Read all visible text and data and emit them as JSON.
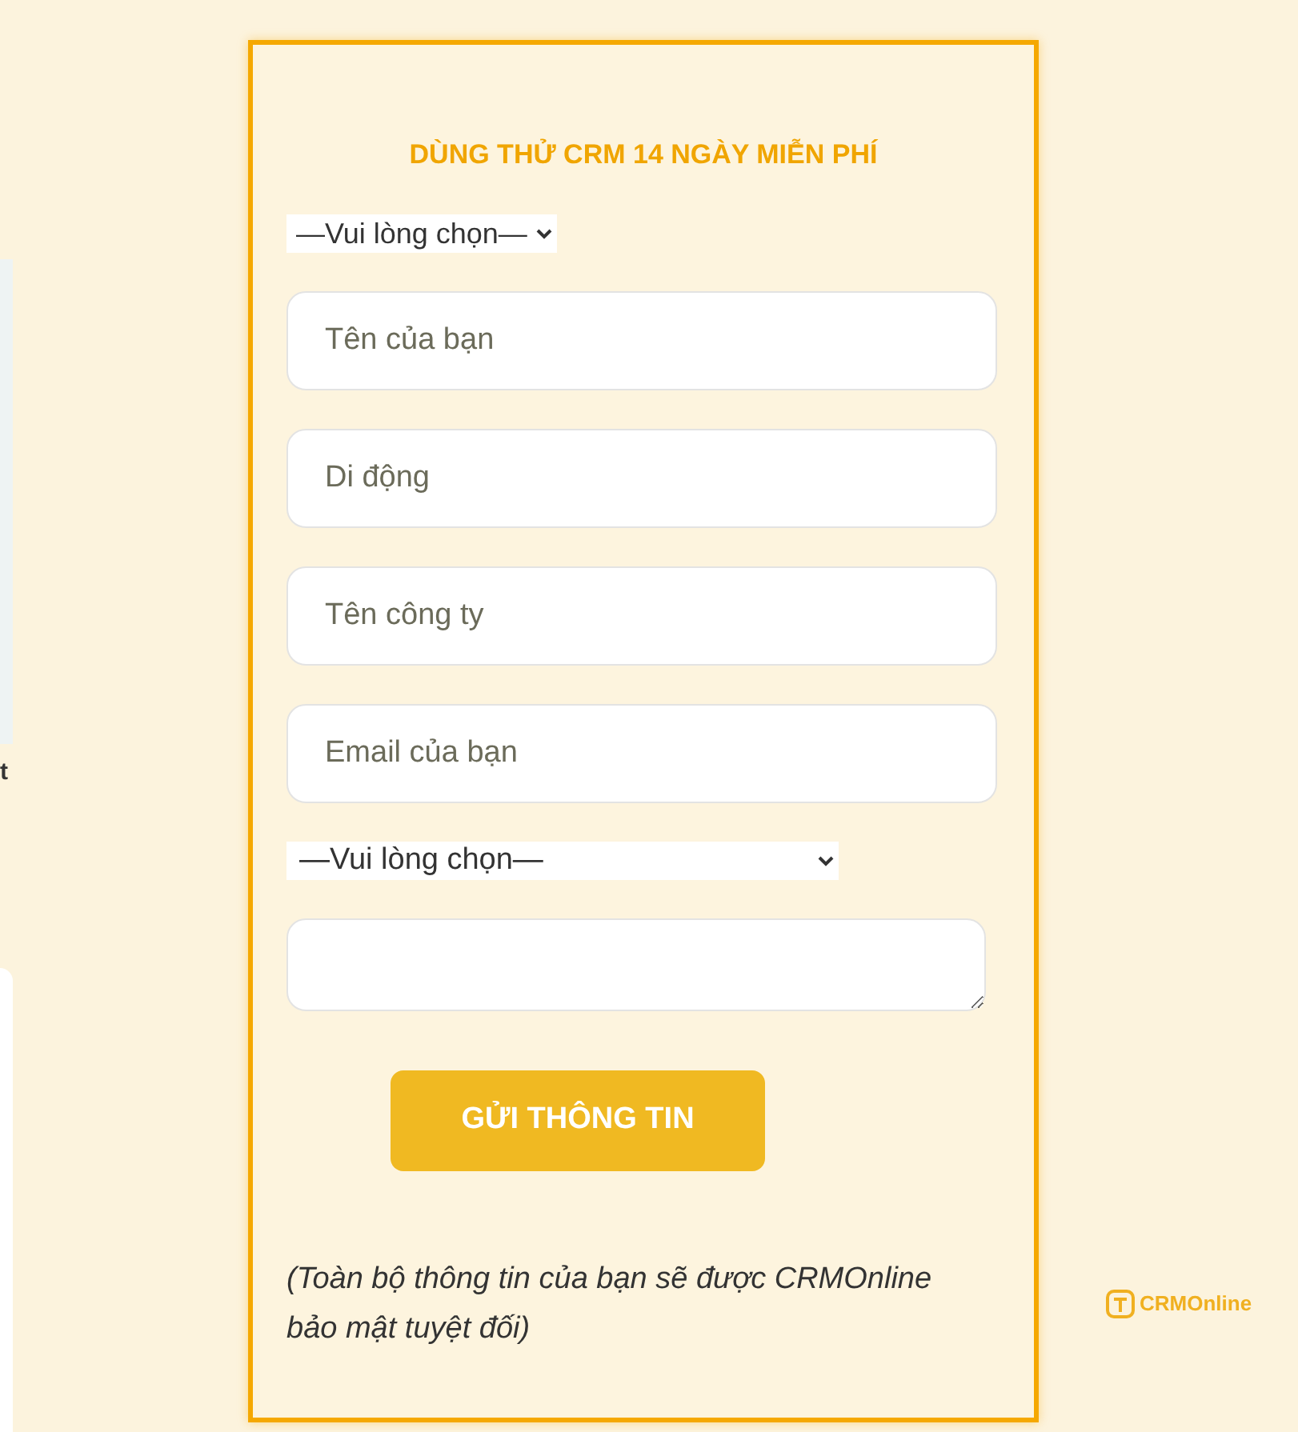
{
  "left_panel": {
    "caption": "t"
  },
  "form": {
    "title": "DÙNG THỬ CRM 14 NGÀY MIỄN PHÍ",
    "fields": [
      {
        "kind": "dropdown",
        "value": "—Vui lòng chọn—"
      },
      {
        "kind": "input",
        "placeholder": "Tên của bạn"
      },
      {
        "kind": "input",
        "placeholder": "Di động"
      },
      {
        "kind": "input",
        "placeholder": "Tên công ty"
      },
      {
        "kind": "input",
        "placeholder": "Email của bạn"
      },
      {
        "kind": "select",
        "value": "—Vui lòng chọn—"
      },
      {
        "kind": "textarea"
      }
    ],
    "submit": "GỬI THÔNG TIN",
    "note": "(Toàn bộ thông tin của bạn sẽ được CRMOnline bảo mật tuyệt đối)"
  },
  "logo": {
    "text": "CRMOnline"
  }
}
